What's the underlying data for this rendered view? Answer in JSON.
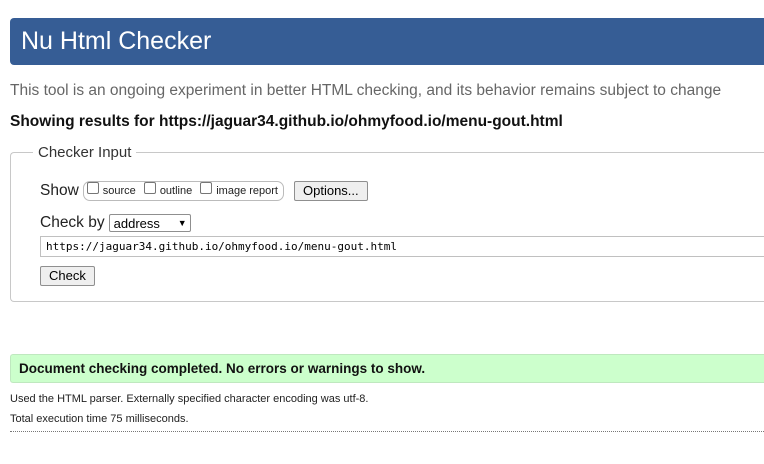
{
  "header": {
    "title": "Nu Html Checker"
  },
  "intro": "This tool is an ongoing experiment in better HTML checking, and its behavior remains subject to change",
  "results_for": "Showing results for https://jaguar34.github.io/ohmyfood.io/menu-gout.html",
  "checker_input": {
    "legend": "Checker Input",
    "show_label": "Show",
    "show_options": [
      {
        "label": "source",
        "checked": false
      },
      {
        "label": "outline",
        "checked": false
      },
      {
        "label": "image report",
        "checked": false
      }
    ],
    "options_button": "Options...",
    "check_by_label": "Check by",
    "check_by_value": "address",
    "url_value": "https://jaguar34.github.io/ohmyfood.io/menu-gout.html",
    "check_button": "Check"
  },
  "result": {
    "message": "Document checking completed. No errors or warnings to show.",
    "parser_info": "Used the HTML parser. Externally specified character encoding was utf-8.",
    "execution_time": "Total execution time 75 milliseconds."
  },
  "colors": {
    "header_bg": "#365d95",
    "success_bg": "#ccffcc"
  }
}
